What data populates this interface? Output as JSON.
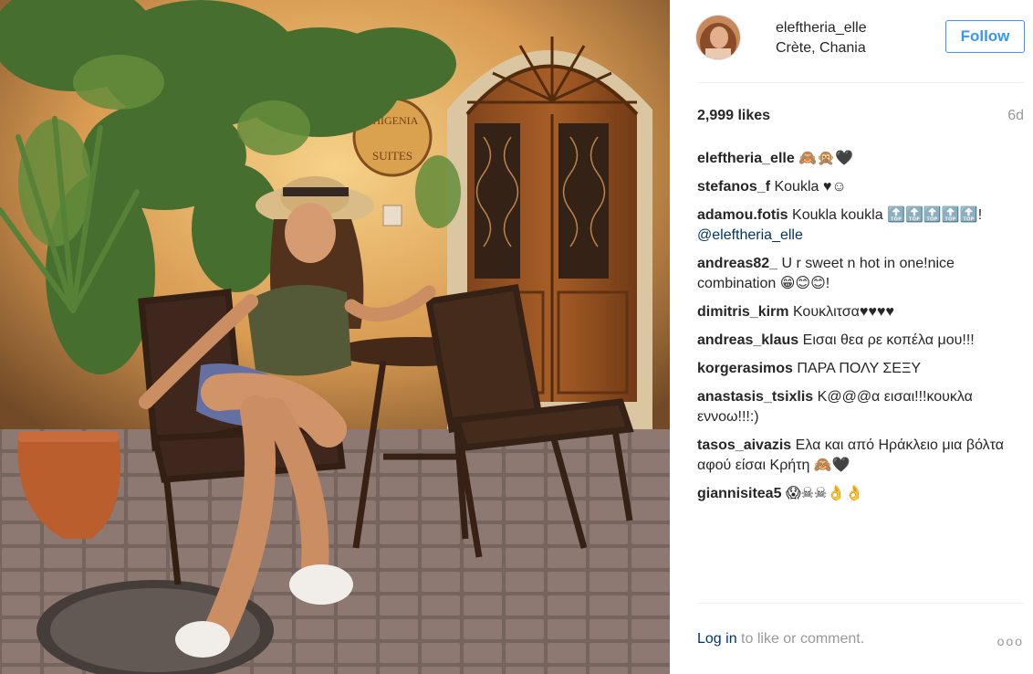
{
  "post": {
    "username": "eleftheria_elle",
    "location": "Crète, Chania",
    "follow_label": "Follow",
    "likes": "2,999 likes",
    "age": "6d",
    "sign_text": "PHIGENIA SUITES"
  },
  "comments": [
    {
      "user": "eleftheria_elle",
      "text": "🙈🙊🖤"
    },
    {
      "user": "stefanos_f",
      "text": "Koukla ♥☺"
    },
    {
      "user": "adamou.fotis",
      "text": "Koukla koukla 🔝🔝🔝🔝🔝!",
      "mention": "@eleftheria_elle"
    },
    {
      "user": "andreas82_",
      "text": "U r sweet n hot in one!nice combination 😁😊😊!"
    },
    {
      "user": "dimitris_kirm",
      "text": "Κουκλιτσα♥♥♥♥"
    },
    {
      "user": "andreas_klaus",
      "text": "Εισαι θεα ρε κοπέλα μου!!!"
    },
    {
      "user": "korgerasimos",
      "text": "ΠΑΡΑ ΠΟΛΥ ΣΕΞΥ"
    },
    {
      "user": "anastasis_tsixlis",
      "text": "Κ@@@α εισαι!!!κουκλα εννοω!!!:)"
    },
    {
      "user": "tasos_aivazis",
      "text": "Ελα και από Ηράκλειο μια βόλτα αφού είσαι Κρήτη 🙈🖤"
    },
    {
      "user": "giannisitea5",
      "text": "😱☠☠👌👌"
    }
  ],
  "footer": {
    "login_link": "Log in",
    "login_rest": " to like or comment.",
    "more": "ooo"
  }
}
